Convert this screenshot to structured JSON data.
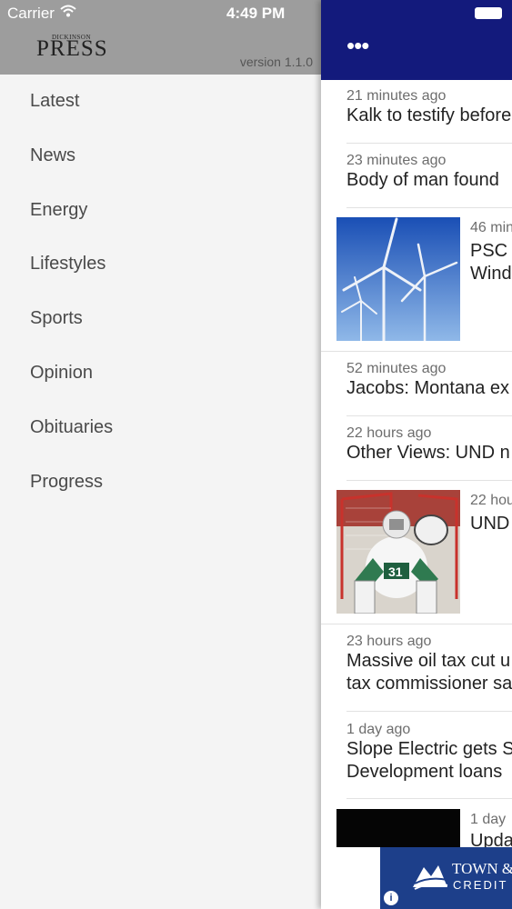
{
  "status_bar": {
    "carrier": "Carrier",
    "time": "4:49 PM"
  },
  "drawer": {
    "logo_top": "DICKINSON",
    "logo_main": "PRESS",
    "version": "version 1.1.0",
    "menu": [
      {
        "label": "Latest"
      },
      {
        "label": "News"
      },
      {
        "label": "Energy"
      },
      {
        "label": "Lifestyles"
      },
      {
        "label": "Sports"
      },
      {
        "label": "Opinion"
      },
      {
        "label": "Obituaries"
      },
      {
        "label": "Progress"
      }
    ]
  },
  "main": {
    "more_label": "•••",
    "articles": [
      {
        "time": "21 minutes ago",
        "headline": "Kalk to testify before",
        "image": "none"
      },
      {
        "time": "23 minutes ago",
        "headline": "Body of man found",
        "image": "none"
      },
      {
        "time": "46 min",
        "headline": "PSC",
        "headline2": "Wind",
        "image": "wind-turbines-photo"
      },
      {
        "time": "52 minutes ago",
        "headline": "Jacobs: Montana ex",
        "image": "none"
      },
      {
        "time": "22 hours ago",
        "headline": "Other Views: UND n",
        "image": "none"
      },
      {
        "time": "22 hou",
        "headline": "UND",
        "image": "hockey-goalie-photo"
      },
      {
        "time": "23 hours ago",
        "headline": "Massive oil tax cut u",
        "headline2": "tax commissioner sa",
        "image": "none"
      },
      {
        "time": "1 day ago",
        "headline": "Slope Electric gets S",
        "headline2": "Development loans",
        "image": "none"
      },
      {
        "time": "1 day",
        "headline": "Upda",
        "image": "dark-photo"
      }
    ]
  },
  "ad": {
    "line1": "TOWN & C",
    "line2": "CREDIT",
    "info": "i"
  },
  "colors": {
    "navbar": "#131a7c",
    "drawer_header": "#9d9d9d",
    "drawer_bg": "#f4f4f4",
    "ad_bg": "#1d3f8a"
  }
}
